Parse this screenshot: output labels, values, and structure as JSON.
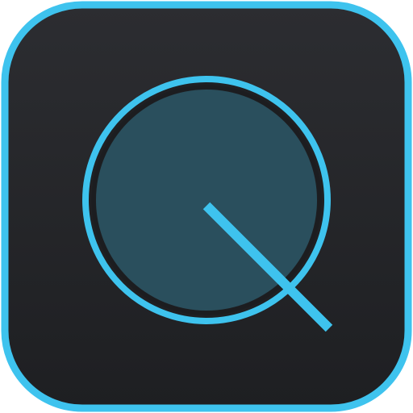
{
  "icon": {
    "name": "magnifier-q-app-icon",
    "colors": {
      "accent": "#3EC3EE",
      "background_top": "#2C2D31",
      "background_bottom": "#1E1F22",
      "lens_fill": "#2A4F5D"
    }
  }
}
